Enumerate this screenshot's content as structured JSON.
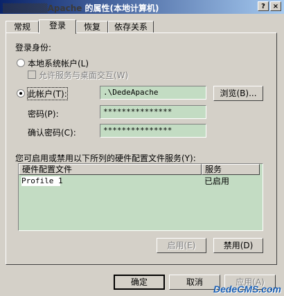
{
  "window": {
    "title_prefix": "▒▒▒▒▒▒▒Apache",
    "title": " 的属性(本地计算机)",
    "help_label": "?",
    "close_label": "×"
  },
  "tabs": [
    {
      "label": "常规",
      "active": false
    },
    {
      "label": "登录",
      "active": true
    },
    {
      "label": "恢复",
      "active": false
    },
    {
      "label": "依存关系",
      "active": false
    }
  ],
  "logon": {
    "section_label": "登录身份:",
    "local_system_label": "本地系统帐户(L)",
    "interact_label": "允许服务与桌面交互(W)",
    "this_account_label": "此帐户(T):",
    "account_value": ".\\DedeApache",
    "browse_label": "浏览(B)...",
    "password_label": "密码(P):",
    "password_value": "***************",
    "confirm_label": "确认密码(C):",
    "confirm_value": "***************"
  },
  "profiles": {
    "section_label": "您可启用或禁用以下所列的硬件配置文件服务(Y):",
    "columns": [
      "硬件配置文件",
      "服务"
    ],
    "rows": [
      {
        "profile": "Profile 1",
        "service": "已启用"
      }
    ],
    "enable_label": "启用(E)",
    "disable_label": "禁用(D)"
  },
  "footer": {
    "ok_label": "确定",
    "cancel_label": "取消",
    "apply_label": "应用(A)"
  },
  "watermark": "DedeCMS.com"
}
